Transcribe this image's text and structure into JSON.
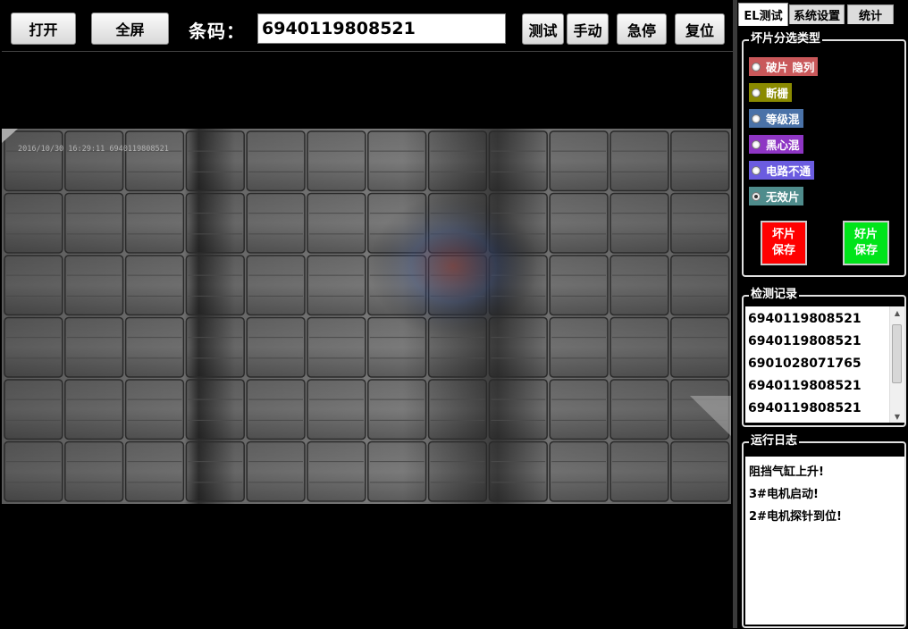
{
  "toolbar": {
    "open_label": "打开",
    "fullscreen_label": "全屏",
    "barcode_label": "条码：",
    "barcode_value": "6940119808521",
    "test_label": "测试",
    "manual_label": "手动",
    "estop_label": "急停",
    "reset_label": "复位"
  },
  "image": {
    "stamp": "2016/10/30 16:29:11  6940119808521"
  },
  "tabs": [
    {
      "label": "EL测试",
      "active": true
    },
    {
      "label": "系统设置",
      "active": false
    },
    {
      "label": "统计",
      "active": false
    }
  ],
  "sort": {
    "title": "坏片分选类型",
    "options": [
      {
        "label": "破片 隐列",
        "color": "#c9585a",
        "checked": false
      },
      {
        "label": "断栅",
        "color": "#8a8a00",
        "checked": false
      },
      {
        "label": "等级混",
        "color": "#4a72a8",
        "checked": false
      },
      {
        "label": "黑心混",
        "color": "#8e35c4",
        "checked": false
      },
      {
        "label": "电路不通",
        "color": "#6b5ce0",
        "checked": false
      },
      {
        "label": "无效片",
        "color": "#4f8c8c",
        "checked": true
      }
    ],
    "bad_save": "坏片\n保存",
    "good_save": "好片\n保存"
  },
  "records": {
    "title": "检测记录",
    "items": [
      "6940119808521",
      "6940119808521",
      "6901028071765",
      "6940119808521",
      "6940119808521"
    ]
  },
  "log": {
    "title": "运行日志",
    "lines": [
      "阻挡气缸上升!",
      "3#电机启动!",
      "2#电机探针到位!"
    ]
  }
}
